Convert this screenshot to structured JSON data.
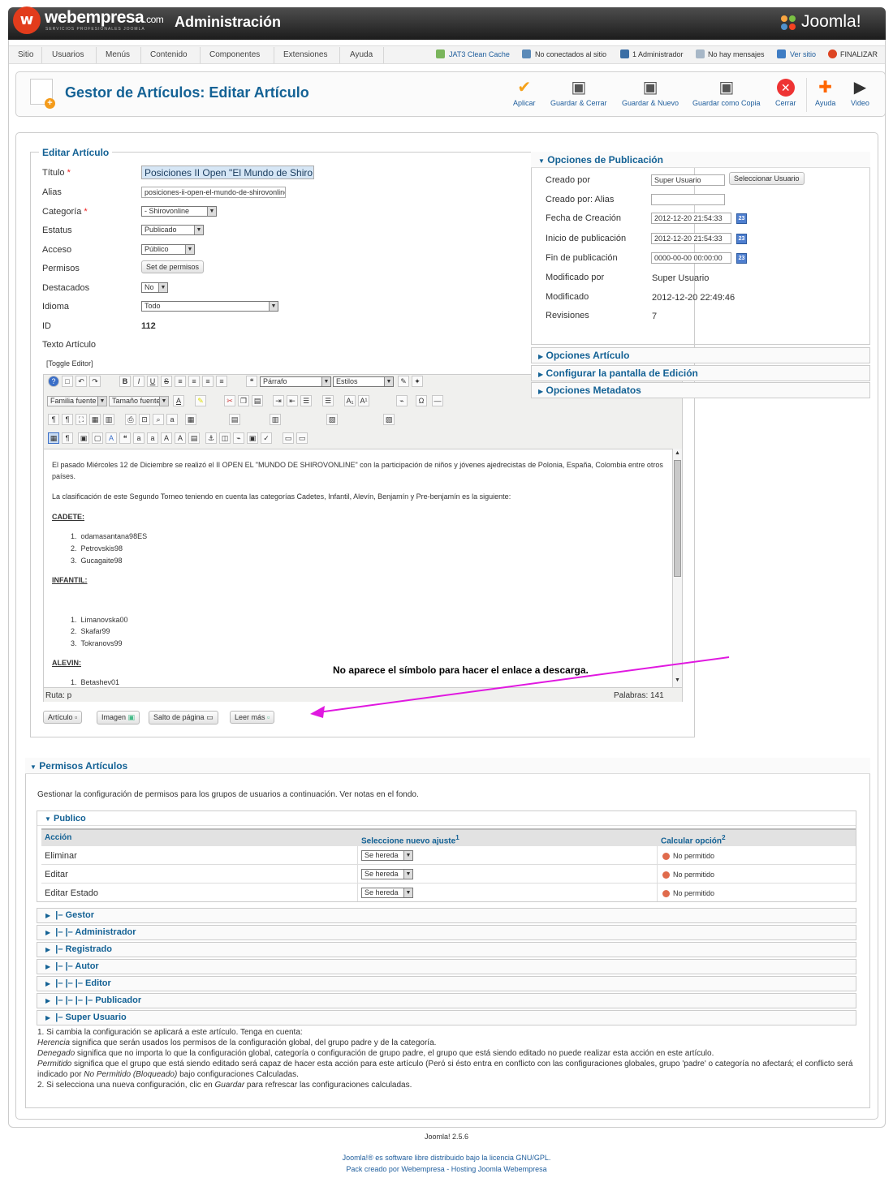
{
  "header": {
    "brand": "webempresa",
    "brand_suffix": ".com",
    "brand_sub": "SERVICIOS PROFESIONALES JOOMLA",
    "admin_title": "Administración",
    "joomla_logo": "Joomla!"
  },
  "menu": [
    "Sitio",
    "Usuarios",
    "Menús",
    "Contenido",
    "Componentes",
    "Extensiones",
    "Ayuda"
  ],
  "status": {
    "cache": "JAT3 Clean Cache",
    "connected": "No conectados al sitio",
    "admin": "1 Administrador",
    "messages": "No hay mensajes",
    "view_site": "Ver sitio",
    "logout": "FINALIZAR"
  },
  "toolbar": {
    "title": "Gestor de Artículos: Editar Artículo",
    "buttons": [
      "Aplicar",
      "Guardar & Cerrar",
      "Guardar & Nuevo",
      "Guardar como Copia",
      "Cerrar",
      "Ayuda",
      "Video"
    ]
  },
  "edit": {
    "legend": "Editar Artículo",
    "fields": {
      "titulo_label": "Título",
      "titulo_value": "Posiciones II Open \"El Mundo de Shiro",
      "alias_label": "Alias",
      "alias_value": "posiciones-ii-open-el-mundo-de-shirovonline",
      "categoria_label": "Categoría",
      "categoria_value": "- Shirovonline",
      "estatus_label": "Estatus",
      "estatus_value": "Publicado",
      "acceso_label": "Acceso",
      "acceso_value": "Público",
      "permisos_label": "Permisos",
      "permisos_button": "Set de permisos",
      "destacados_label": "Destacados",
      "destacados_value": "No",
      "idioma_label": "Idioma",
      "idioma_value": "Todo",
      "id_label": "ID",
      "id_value": "112",
      "texto_label": "Texto Artículo"
    },
    "toggle": "[Toggle Editor]",
    "editor_toolbar": {
      "format": "Párrafo",
      "styles": "Estilos",
      "font_family": "Familia fuente",
      "font_size": "Tamaño fuente"
    },
    "content": {
      "p1": "El pasado Miércoles 12 de Diciembre se realizó el II OPEN EL \"MUNDO DE SHIROVONLINE\" con la participación de niños y jóvenes ajedrecistas de Polonia, España, Colombia entre otros países.",
      "p2": "La clasificación de este Segundo Torneo teniendo en cuenta las categorías Cadetes, Infantil, Alevín, Benjamín y Pre-benjamín es la siguiente:",
      "cadete": "CADETE:",
      "cadete_list": [
        "odamasantana98ES",
        "Petrovskis98",
        "Gucagaite98"
      ],
      "infantil": "INFANTIL:",
      "infantil_list": [
        "Limanovska00",
        "Skafar99",
        "Tokranovs99"
      ],
      "alevin": "ALEVIN:",
      "alevin_list": [
        "Betashev01"
      ]
    },
    "ruta": "Ruta: p",
    "palabras": "Palabras: 141",
    "bottom_buttons": [
      "Artículo",
      "Imagen",
      "Salto de página",
      "Leer más"
    ]
  },
  "annotation": "No aparece el símbolo para hacer el enlace a descarga.",
  "publishing": {
    "title": "Opciones de Publicación",
    "creado_por_label": "Creado por",
    "creado_por_value": "Super Usuario",
    "select_user": "Seleccionar Usuario",
    "alias_label": "Creado por: Alias",
    "fecha_label": "Fecha de Creación",
    "fecha_value": "2012-12-20 21:54:33",
    "inicio_label": "Inicio de publicación",
    "inicio_value": "2012-12-20 21:54:33",
    "fin_label": "Fin de publicación",
    "fin_value": "0000-00-00 00:00:00",
    "mod_por_label": "Modificado por",
    "mod_por_value": "Super Usuario",
    "mod_label": "Modificado",
    "mod_value": "2012-12-20 22:49:46",
    "rev_label": "Revisiones",
    "rev_value": "7",
    "cal_label": "23"
  },
  "panels": [
    "Opciones Artículo",
    "Configurar la pantalla de Edición",
    "Opciones Metadatos"
  ],
  "permissions": {
    "title": "Permisos Artículos",
    "desc": "Gestionar la configuración de permisos para los grupos de usuarios a continuación. Ver notas en el fondo.",
    "group_open": "Publico",
    "headers": [
      "Acción",
      "Seleccione nuevo ajuste",
      "Calcular opción"
    ],
    "sup1": "1",
    "sup2": "2",
    "rows": [
      {
        "action": "Eliminar",
        "setting": "Se hereda",
        "calc": "No permitido"
      },
      {
        "action": "Editar",
        "setting": "Se hereda",
        "calc": "No permitido"
      },
      {
        "action": "Editar Estado",
        "setting": "Se hereda",
        "calc": "No permitido"
      }
    ],
    "groups": [
      "|– Gestor",
      "|– |– Administrador",
      "|– Registrado",
      "|– |– Autor",
      "|– |– |– Editor",
      "|– |– |– |– Publicador",
      "|– Super Usuario"
    ]
  },
  "notes": {
    "n1": "1. Si cambia la configuración se aplicará a este artículo. Tenga en cuenta:",
    "n2a": "Herencia",
    "n2b": " significa que serán usados los permisos de la configuración global, del grupo padre y de la categoría.",
    "n3a": "Denegado",
    "n3b": " significa que no importa lo que la configuración global, categoría o configuración de grupo padre, el grupo que está siendo editado no puede realizar esta acción en este artículo.",
    "n4a": "Permitido",
    "n4b": " significa que el grupo que está siendo editado será capaz de hacer esta acción para este artículo (Peró si ésto entra en conflicto con las configuraciones globales, grupo 'padre' o categoría no afectará; el conflicto será indicado por ",
    "n4c": "No Permitido (Bloqueado)",
    "n4d": " bajo configuraciones Calculadas.",
    "n5a": "2. Si selecciona una nueva configuración, clic en ",
    "n5b": "Guardar",
    "n5c": " para refrescar las configuraciones calculadas."
  },
  "footer": {
    "version": "Joomla! 2.5.6",
    "license": "Joomla!® es software libre distribuido bajo la licencia GNU/GPL.",
    "pack": "Pack creado por Webempresa - Hosting Joomla Webempresa"
  }
}
